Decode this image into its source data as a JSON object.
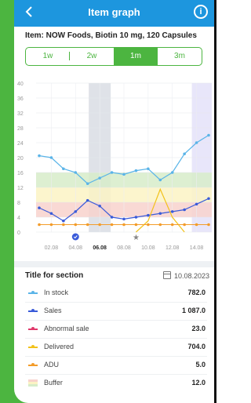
{
  "header": {
    "title": "Item graph",
    "back_icon": "chevron-left-icon",
    "info_icon": "info-icon"
  },
  "item": {
    "title": "Item: NOW Foods, Biotin 10 mg, 120 Capsules"
  },
  "tabs": [
    {
      "label": "1w",
      "active": false
    },
    {
      "label": "2w",
      "active": false
    },
    {
      "label": "1m",
      "active": true
    },
    {
      "label": "3m",
      "active": false
    }
  ],
  "colors": {
    "accent": "#4cb540",
    "appbar": "#1d96de",
    "in_stock": "#5ab4e8",
    "sales": "#3a5bd9",
    "abnormal_sale": "#e0386b",
    "delivered": "#f2c21b",
    "adu": "#f39c2a",
    "buffer_green": "#d7ecc9",
    "buffer_yellow": "#fbf3c4",
    "buffer_red": "#f8d2cc"
  },
  "chart_data": {
    "type": "line",
    "y_ticks": [
      "0",
      "4",
      "8",
      "12",
      "16",
      "20",
      "24",
      "28",
      "32",
      "36",
      "40"
    ],
    "ylim": [
      0,
      40
    ],
    "x": [
      "01.08",
      "02.08",
      "03.08",
      "04.08",
      "05.08",
      "06.08",
      "07.08",
      "08.08",
      "09.08",
      "10.08",
      "11.08",
      "12.08",
      "13.08",
      "14.08",
      "15.08"
    ],
    "x_tick_labels": [
      "02.08",
      "04.08",
      "06.08",
      "08.08",
      "10.08",
      "12.08",
      "14.08"
    ],
    "selected_x_label": "06.08",
    "series": [
      {
        "name": "In stock",
        "values": [
          20.5,
          20,
          17,
          16,
          13,
          14.5,
          16,
          15.5,
          16.5,
          17,
          14,
          16,
          21,
          24,
          26
        ]
      },
      {
        "name": "Sales",
        "values": [
          6.5,
          5,
          3,
          5.5,
          8.5,
          7,
          4,
          3.5,
          4,
          4.5,
          5,
          5.5,
          6,
          7.5,
          9
        ]
      },
      {
        "name": "Delivered",
        "values": [
          null,
          null,
          null,
          null,
          null,
          null,
          null,
          null,
          0,
          3,
          11.5,
          4,
          0,
          null,
          null
        ]
      },
      {
        "name": "ADU",
        "values": [
          2,
          2,
          2,
          2,
          2,
          2,
          2,
          2,
          2,
          2,
          2,
          2,
          2,
          2,
          2
        ]
      }
    ],
    "buffer_zones": [
      {
        "zone": "green",
        "from": 12,
        "to": 16
      },
      {
        "zone": "yellow",
        "from": 8,
        "to": 12
      },
      {
        "zone": "red",
        "from": 4,
        "to": 8
      }
    ],
    "markers": [
      {
        "x": "04.08",
        "type": "blue-check-dot"
      },
      {
        "x": "09.08",
        "type": "star"
      }
    ]
  },
  "section": {
    "title": "Title for section",
    "date": "10.08.2023",
    "calendar_icon": "calendar-icon",
    "rows": [
      {
        "label": "In stock",
        "value": "782.0",
        "key": "in_stock"
      },
      {
        "label": "Sales",
        "value": "1 087.0",
        "key": "sales"
      },
      {
        "label": "Abnormal sale",
        "value": "23.0",
        "key": "abnormal_sale"
      },
      {
        "label": "Delivered",
        "value": "704.0",
        "key": "delivered"
      },
      {
        "label": "ADU",
        "value": "5.0",
        "key": "adu"
      },
      {
        "label": "Buffer",
        "value": "12.0",
        "key": "buffer"
      }
    ]
  }
}
